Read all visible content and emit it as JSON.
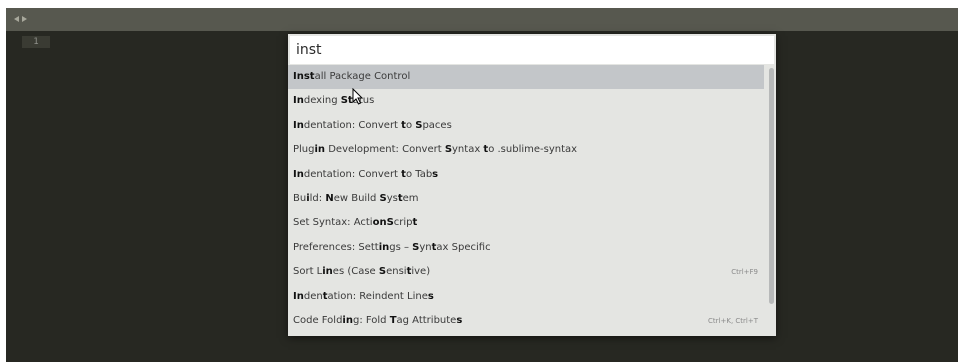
{
  "editor": {
    "line_number": "1",
    "nav_icons": [
      "arrow-left-icon",
      "arrow-right-icon"
    ]
  },
  "palette": {
    "query": "inst",
    "items": [
      {
        "segments": [
          [
            "Inst",
            true
          ],
          [
            "all Package Control",
            false
          ]
        ],
        "shortcut": "",
        "selected": true
      },
      {
        "segments": [
          [
            "In",
            true
          ],
          [
            "dexing ",
            false
          ],
          [
            "St",
            true
          ],
          [
            "atus",
            false
          ]
        ],
        "shortcut": "",
        "selected": false
      },
      {
        "segments": [
          [
            "In",
            true
          ],
          [
            "dentation: Convert ",
            false
          ],
          [
            "t",
            true
          ],
          [
            "o ",
            false
          ],
          [
            "S",
            true
          ],
          [
            "paces",
            false
          ]
        ],
        "shortcut": "",
        "selected": false
      },
      {
        "segments": [
          [
            "Plug",
            false
          ],
          [
            "in",
            true
          ],
          [
            " Development: Convert ",
            false
          ],
          [
            "S",
            true
          ],
          [
            "yntax ",
            false
          ],
          [
            "t",
            true
          ],
          [
            "o .sublime-syntax",
            false
          ]
        ],
        "shortcut": "",
        "selected": false
      },
      {
        "segments": [
          [
            "In",
            true
          ],
          [
            "dentation: Convert ",
            false
          ],
          [
            "t",
            true
          ],
          [
            "o Tab",
            false
          ],
          [
            "s",
            true
          ]
        ],
        "shortcut": "",
        "selected": false
      },
      {
        "segments": [
          [
            "Bu",
            false
          ],
          [
            "i",
            true
          ],
          [
            "ld: ",
            false
          ],
          [
            "N",
            true
          ],
          [
            "ew Build ",
            false
          ],
          [
            "S",
            true
          ],
          [
            "ys",
            false
          ],
          [
            "t",
            true
          ],
          [
            "em",
            false
          ]
        ],
        "shortcut": "",
        "selected": false
      },
      {
        "segments": [
          [
            "Set Syntax: Acti",
            false
          ],
          [
            "on",
            true
          ],
          [
            "S",
            true
          ],
          [
            "crip",
            false
          ],
          [
            "t",
            true
          ]
        ],
        "shortcut": "",
        "selected": false
      },
      {
        "segments": [
          [
            "Preferences: Sett",
            false
          ],
          [
            "in",
            true
          ],
          [
            "gs – ",
            false
          ],
          [
            "S",
            true
          ],
          [
            "yn",
            false
          ],
          [
            "t",
            true
          ],
          [
            "ax Specific",
            false
          ]
        ],
        "shortcut": "",
        "selected": false
      },
      {
        "segments": [
          [
            "Sort L",
            false
          ],
          [
            "in",
            true
          ],
          [
            "es (Case ",
            false
          ],
          [
            "S",
            true
          ],
          [
            "ensi",
            false
          ],
          [
            "t",
            true
          ],
          [
            "ive)",
            false
          ]
        ],
        "shortcut": "Ctrl+F9",
        "selected": false
      },
      {
        "segments": [
          [
            "In",
            true
          ],
          [
            "den",
            false
          ],
          [
            "t",
            true
          ],
          [
            "ation: Reindent Line",
            false
          ],
          [
            "s",
            true
          ]
        ],
        "shortcut": "",
        "selected": false
      },
      {
        "segments": [
          [
            "Code Fold",
            false
          ],
          [
            "in",
            true
          ],
          [
            "g: Fold ",
            false
          ],
          [
            "T",
            true
          ],
          [
            "ag Attribute",
            false
          ],
          [
            "s",
            true
          ]
        ],
        "shortcut": "Ctrl+K, Ctrl+T",
        "selected": false
      }
    ]
  }
}
